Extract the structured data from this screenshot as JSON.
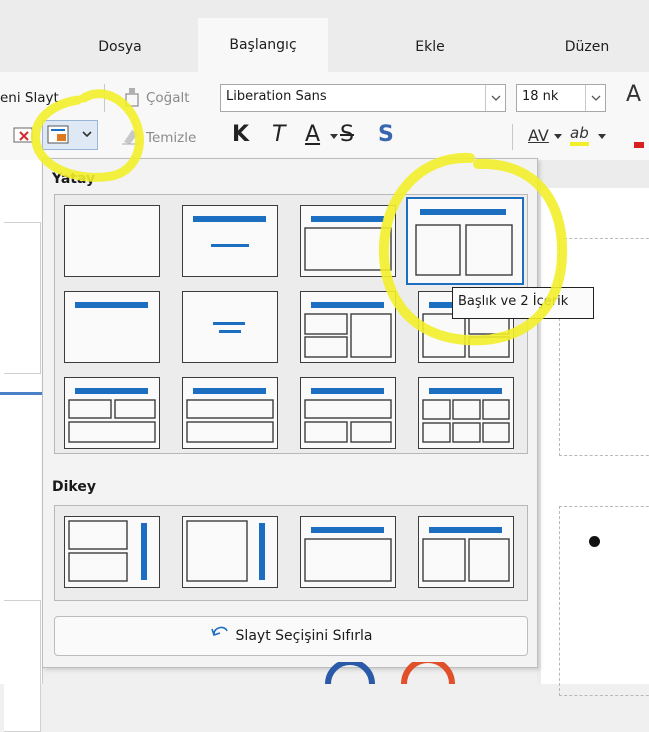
{
  "tabs": [
    {
      "label": "Dosya",
      "active": false
    },
    {
      "label": "Başlangıç",
      "active": true
    },
    {
      "label": "Ekle",
      "active": false
    },
    {
      "label": "Düzen",
      "active": false
    }
  ],
  "toolbar": {
    "new_slide_label": "eni Slayt",
    "duplicate_label": "Çoğalt",
    "font_name": "Liberation Sans",
    "font_size": "18 nk",
    "clear_label": "Temizle",
    "bold_glyph": "K",
    "italic_glyph": "T",
    "underline_glyph": "A",
    "strike_glyph": "S",
    "shadow_glyph": "S",
    "spacing_glyph": "AV",
    "highlight_glyph": "ab",
    "grow_glyph": "A"
  },
  "layout_popup": {
    "section_landscape": "Yatay",
    "section_portrait": "Dikey",
    "reset_button": "Slayt Seçişini Sıfırla",
    "tooltip": "Başlık ve 2 İçerik",
    "selected_layout": "title-two-content"
  },
  "colors": {
    "accent": "#1c6fc0",
    "highlight_marker": "#f2ee2a"
  }
}
